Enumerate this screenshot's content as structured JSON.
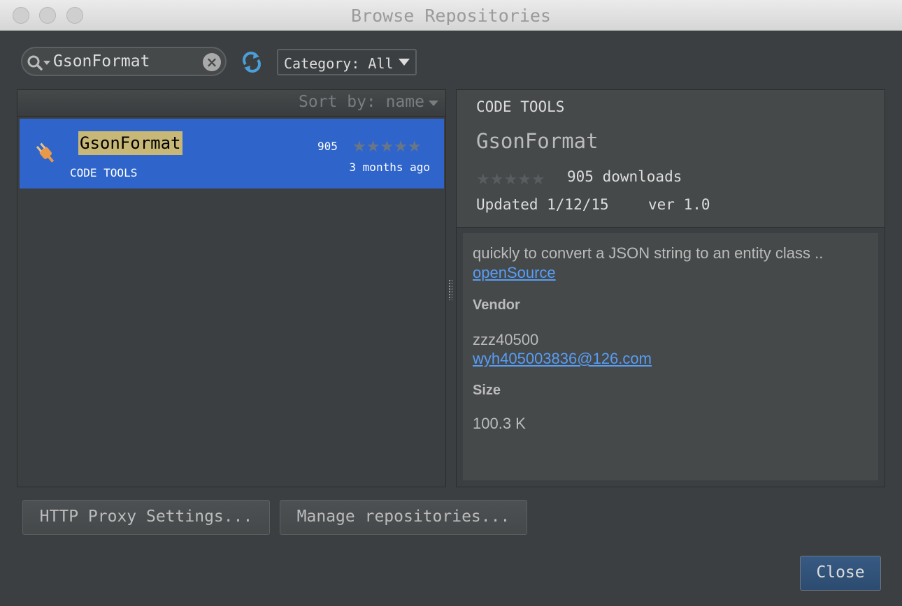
{
  "window": {
    "title": "Browse Repositories"
  },
  "toolbar": {
    "search_value": "GsonFormat",
    "category_label": "Category: All"
  },
  "list": {
    "sort_label": "Sort by: name",
    "items": [
      {
        "name": "GsonFormat",
        "category": "CODE TOOLS",
        "downloads": "905",
        "stars": "★★★★★",
        "updated": "3 months ago"
      }
    ]
  },
  "detail": {
    "category": "CODE TOOLS",
    "name": "GsonFormat",
    "stars": "★★★★★",
    "downloads": "905 downloads",
    "updated": "Updated 1/12/15",
    "version": "ver 1.0",
    "description": "quickly to convert a JSON string to an entity class ..",
    "link_text": "openSource",
    "vendor_heading": "Vendor",
    "vendor_name": "zzz40500",
    "vendor_email": "wyh405003836@126.com",
    "size_heading": "Size",
    "size_value": "100.3 K"
  },
  "buttons": {
    "proxy": "HTTP Proxy Settings...",
    "manage": "Manage repositories...",
    "close": "Close"
  },
  "colors": {
    "selection": "#2f65ca",
    "link": "#589df6",
    "highlight": "#c8b878",
    "background": "#3c3f41"
  },
  "icons": [
    "search-icon",
    "clear-icon",
    "refresh-icon",
    "plug-icon",
    "chevron-down-icon"
  ]
}
